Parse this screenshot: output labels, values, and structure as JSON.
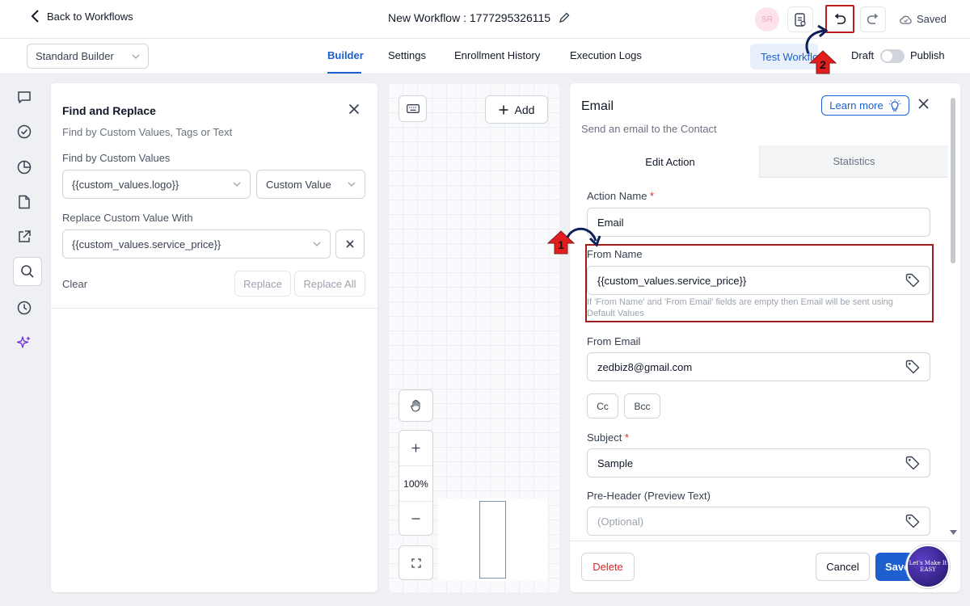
{
  "header": {
    "back_label": "Back to Workflows",
    "workflow_title": "New Workflow : 1777295326115",
    "avatar_initials": "SR",
    "saved_label": "Saved"
  },
  "subbar": {
    "builder_select": "Standard Builder",
    "tabs": [
      {
        "label": "Builder",
        "active": true
      },
      {
        "label": "Settings"
      },
      {
        "label": "Enrollment History"
      },
      {
        "label": "Execution Logs"
      }
    ],
    "test_button": "Test Workflow",
    "draft_label": "Draft",
    "publish_label": "Publish"
  },
  "find_replace": {
    "title": "Find and Replace",
    "subtitle": "Find by Custom Values, Tags or Text",
    "find_label": "Find by Custom Values",
    "find_value": "{{custom_values.logo}}",
    "find_type": "Custom Value",
    "replace_label": "Replace Custom Value With",
    "replace_value": "{{custom_values.service_price}}",
    "clear_label": "Clear",
    "replace_button": "Replace",
    "replace_all_button": "Replace All"
  },
  "canvas": {
    "add_label": "Add",
    "zoom_level": "100%"
  },
  "email_panel": {
    "title": "Email",
    "subtitle": "Send an email to the Contact",
    "learn_more": "Learn more",
    "tabs": [
      "Edit Action",
      "Statistics"
    ],
    "action_name_label": "Action Name",
    "action_name_value": "Email",
    "from_name_label": "From Name",
    "from_name_value": "{{custom_values.service_price}}",
    "from_hint": "If 'From Name' and 'From Email' fields are empty then Email will be sent using Default Values",
    "from_email_label": "From Email",
    "from_email_value": "zedbiz8@gmail.com",
    "cc_label": "Cc",
    "bcc_label": "Bcc",
    "subject_label": "Subject",
    "subject_value": "Sample",
    "preheader_label": "Pre-Header (Preview Text)",
    "preheader_placeholder": "(Optional)",
    "required_mark": "*",
    "delete_label": "Delete",
    "cancel_label": "Cancel",
    "save_label": "Save"
  },
  "annotations": {
    "step1": "1",
    "step2": "2",
    "watermark": "Let's Make It EASY"
  },
  "colors": {
    "accent": "#1d5fcf",
    "highlight": "#9b1c1c",
    "badge": "#e11d1d"
  },
  "icons": [
    "chevron-left-icon",
    "pencil-icon",
    "document-icon",
    "undo-icon",
    "redo-icon",
    "cloud-check-icon",
    "chevron-down-icon",
    "close-icon",
    "message-icon",
    "check-circle-icon",
    "pie-chart-icon",
    "file-icon",
    "external-link-icon",
    "search-icon",
    "clock-icon",
    "sparkles-icon",
    "keyboard-icon",
    "plus-icon",
    "hand-icon",
    "minus-icon",
    "fit-screen-icon",
    "bulb-icon",
    "tag-icon"
  ]
}
